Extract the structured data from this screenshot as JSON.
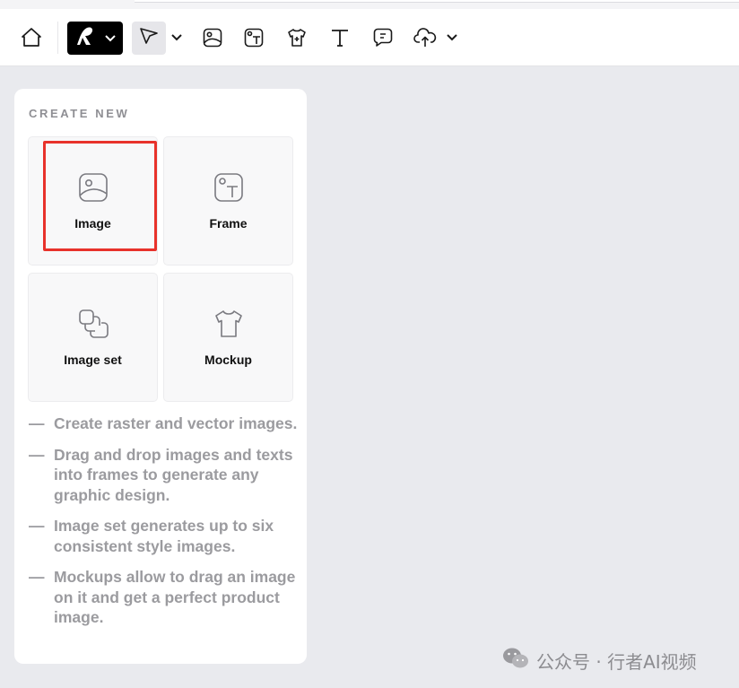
{
  "toolbar": {
    "items": [
      {
        "name": "home-icon"
      },
      {
        "name": "brand-logo-icon"
      },
      {
        "name": "select-arrow-icon"
      },
      {
        "name": "image-icon"
      },
      {
        "name": "frame-icon"
      },
      {
        "name": "mockup-shirt-icon"
      },
      {
        "name": "text-icon"
      },
      {
        "name": "comment-icon"
      },
      {
        "name": "upload-cloud-icon"
      }
    ]
  },
  "panel": {
    "title": "CREATE NEW",
    "cards": [
      {
        "label": "Image",
        "icon": "image-icon"
      },
      {
        "label": "Frame",
        "icon": "frame-icon"
      },
      {
        "label": "Image set",
        "icon": "image-set-icon"
      },
      {
        "label": "Mockup",
        "icon": "mockup-shirt-icon"
      }
    ],
    "notes": [
      {
        "dash": "—",
        "text": "Create raster and vector images."
      },
      {
        "dash": "—",
        "text": "Drag and drop images and texts into frames to generate any graphic design."
      },
      {
        "dash": "—",
        "text": "Image set generates up to six consistent style images."
      },
      {
        "dash": "—",
        "text": "Mockups allow to drag an image on it and get a perfect product image."
      }
    ]
  },
  "watermark": {
    "text": "公众号 · 行者AI视频",
    "icon": "wechat-icon"
  },
  "colors": {
    "highlight": "#e8322b",
    "brand": "#000000",
    "canvas": "#e9eaee"
  }
}
